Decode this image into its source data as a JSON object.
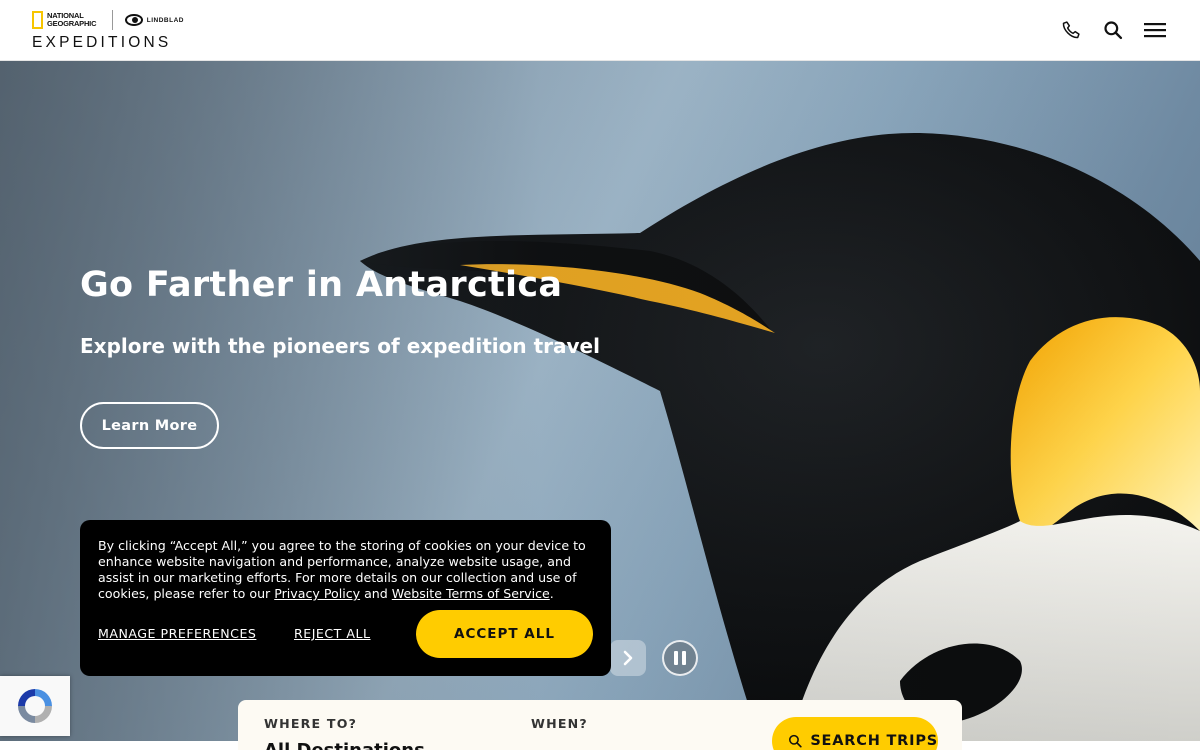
{
  "header": {
    "logo": {
      "national_geographic": "NATIONAL GEOGRAPHIC",
      "lindblad": "LINDBLAD",
      "expeditions": "EXPEDITIONS"
    },
    "icons": [
      "phone-icon",
      "search-icon",
      "hamburger-menu-icon"
    ]
  },
  "hero": {
    "title": "Go Farther in Antarctica",
    "subtitle": "Explore with the pioneers of expedition travel",
    "cta_label": "Learn More"
  },
  "cookie_banner": {
    "text_before": "By clicking “Accept All,” you agree to the storing of cookies on your device to enhance website navigation and performance, analyze website usage, and assist in our marketing efforts.  For more details on our collection and use of cookies, please refer to our ",
    "privacy_link": "Privacy Policy",
    "and_text": " and ",
    "terms_link": "Website Terms of Service",
    "period": ".",
    "manage_label": "MANAGE PREFERENCES",
    "reject_label": "REJECT ALL",
    "accept_label": "ACCEPT ALL"
  },
  "search_panel": {
    "where_label": "WHERE TO?",
    "where_value": "All Destinations",
    "when_label": "WHEN?",
    "search_label": "SEARCH TRIPS"
  },
  "colors": {
    "accent": "#ffcc00",
    "banner_bg": "#000000",
    "header_bg": "#ffffff"
  }
}
